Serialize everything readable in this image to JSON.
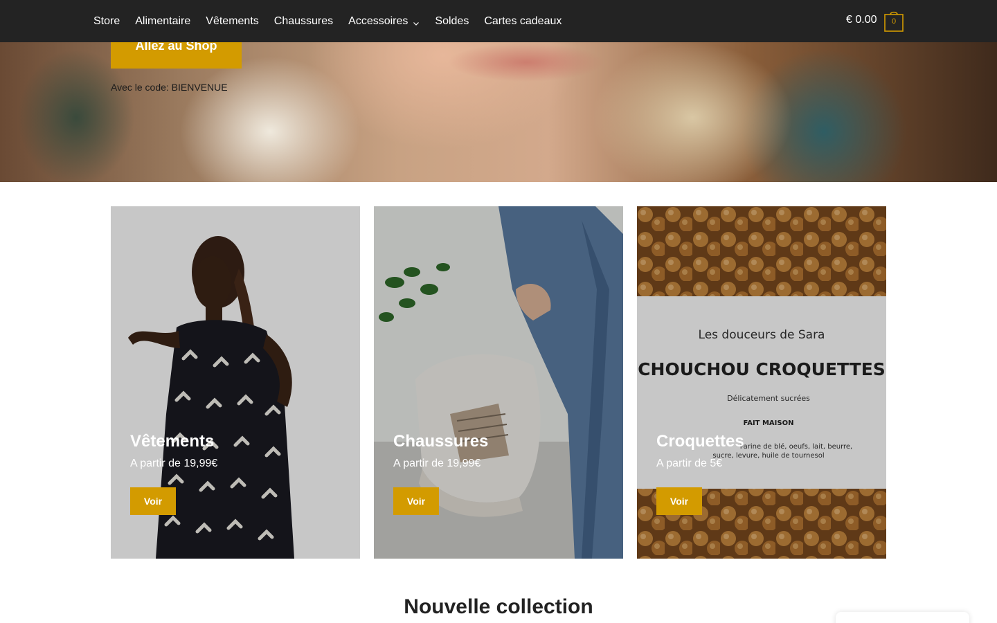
{
  "header": {
    "nav": [
      {
        "label": "Store"
      },
      {
        "label": "Alimentaire"
      },
      {
        "label": "Vêtements"
      },
      {
        "label": "Chaussures"
      },
      {
        "label": "Accessoires",
        "has_dropdown": true
      },
      {
        "label": "Soldes"
      },
      {
        "label": "Cartes cadeaux"
      }
    ],
    "cart_total": "€ 0.00",
    "cart_count": "0",
    "icons": {
      "dropdown": "chevron-down-icon",
      "cart": "shopping-bag-icon"
    }
  },
  "hero": {
    "button_label": "Allez au Shop",
    "code_text": "Avec le code: BIENVENUE"
  },
  "cards": [
    {
      "title": "Vêtements",
      "subtitle": "A partir de 19,99€",
      "button": "Voir"
    },
    {
      "title": "Chaussures",
      "subtitle": "A partir de 19,99€",
      "button": "Voir"
    },
    {
      "title": "Croquettes",
      "subtitle": "A partir de 5€",
      "button": "Voir",
      "image_text": {
        "brand": "Les douceurs de Sara",
        "product": "CHOUCHOU CROQUETTES",
        "tagline": "Délicatement sucrées",
        "badge": "FAIT MAISON",
        "ingredients_line1": "Farine de blé, oeufs, lait, beurre,",
        "ingredients_line2": "sucre, levure, huile de tournesol"
      }
    }
  ],
  "section_title": "Nouvelle collection",
  "colors": {
    "accent": "#d39b00",
    "header_bg": "#232323"
  }
}
